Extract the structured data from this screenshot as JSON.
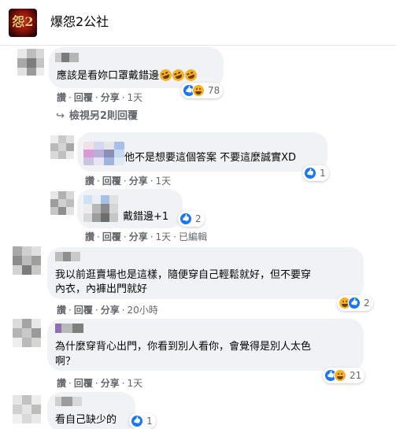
{
  "group": {
    "name": "爆怨2公社",
    "logo_text": "怨2",
    "logo_icon": "game-logo"
  },
  "actions": {
    "like": "讚",
    "reply": "回覆",
    "share": "分享",
    "edited": "已編輯",
    "sep": "·"
  },
  "view_more_replies": "檢視另2則回覆",
  "reaction_colors": {
    "like": "#1877f2",
    "haha": "#f7b125"
  },
  "comments": [
    {
      "text": "應該是看妳口罩戴錯邊",
      "emoji": [
        "haha-emoji",
        "haha-emoji",
        "haha-emoji"
      ],
      "time": "1天",
      "reactions": [
        "like",
        "haha"
      ],
      "count": "78"
    },
    {
      "text": "他不是想要這個答案  不要這麼誠實XD",
      "time": "1天",
      "reactions": [
        "like"
      ],
      "count": "1"
    },
    {
      "text": "戴錯邊+1",
      "time": "1天",
      "edited": true,
      "reactions": [
        "like"
      ],
      "count": "2"
    },
    {
      "text_lines": [
        "我以前逛賣場也是這樣，隨便穿自己輕鬆就好，但不要穿",
        "內衣，內褲出門就好"
      ],
      "time": "20小時",
      "reactions": [
        "haha",
        "like"
      ],
      "count": "2"
    },
    {
      "text_lines": [
        "為什麼穿背心出門，你看到別人看你，會覺得是別人太色",
        "啊？"
      ],
      "time": "1天",
      "reactions": [
        "like",
        "haha"
      ],
      "count": "21"
    },
    {
      "text": "看自己缺少的",
      "reactions": [
        "like"
      ],
      "count": "1"
    }
  ]
}
